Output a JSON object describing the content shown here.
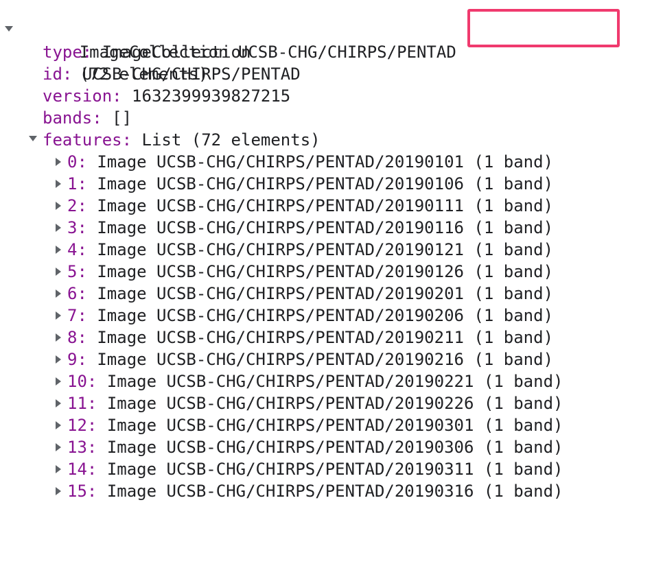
{
  "root": {
    "title": "ImageCollection UCSB-CHG/CHIRPS/PENTAD",
    "count": "(72 elements)"
  },
  "props": [
    {
      "key": "type:",
      "value": "ImageCollection"
    },
    {
      "key": "id:",
      "value": "UCSB-CHG/CHIRPS/PENTAD"
    },
    {
      "key": "version:",
      "value": "1632399939827215"
    },
    {
      "key": "bands:",
      "value": "[]"
    }
  ],
  "features": {
    "key": "features:",
    "value": "List (72 elements)"
  },
  "items": [
    {
      "index": "0:",
      "value": "Image UCSB-CHG/CHIRPS/PENTAD/20190101 (1 band)"
    },
    {
      "index": "1:",
      "value": "Image UCSB-CHG/CHIRPS/PENTAD/20190106 (1 band)"
    },
    {
      "index": "2:",
      "value": "Image UCSB-CHG/CHIRPS/PENTAD/20190111 (1 band)"
    },
    {
      "index": "3:",
      "value": "Image UCSB-CHG/CHIRPS/PENTAD/20190116 (1 band)"
    },
    {
      "index": "4:",
      "value": "Image UCSB-CHG/CHIRPS/PENTAD/20190121 (1 band)"
    },
    {
      "index": "5:",
      "value": "Image UCSB-CHG/CHIRPS/PENTAD/20190126 (1 band)"
    },
    {
      "index": "6:",
      "value": "Image UCSB-CHG/CHIRPS/PENTAD/20190201 (1 band)"
    },
    {
      "index": "7:",
      "value": "Image UCSB-CHG/CHIRPS/PENTAD/20190206 (1 band)"
    },
    {
      "index": "8:",
      "value": "Image UCSB-CHG/CHIRPS/PENTAD/20190211 (1 band)"
    },
    {
      "index": "9:",
      "value": "Image UCSB-CHG/CHIRPS/PENTAD/20190216 (1 band)"
    },
    {
      "index": "10:",
      "value": "Image UCSB-CHG/CHIRPS/PENTAD/20190221 (1 band)"
    },
    {
      "index": "11:",
      "value": "Image UCSB-CHG/CHIRPS/PENTAD/20190226 (1 band)"
    },
    {
      "index": "12:",
      "value": "Image UCSB-CHG/CHIRPS/PENTAD/20190301 (1 band)"
    },
    {
      "index": "13:",
      "value": "Image UCSB-CHG/CHIRPS/PENTAD/20190306 (1 band)"
    },
    {
      "index": "14:",
      "value": "Image UCSB-CHG/CHIRPS/PENTAD/20190311 (1 band)"
    },
    {
      "index": "15:",
      "value": "Image UCSB-CHG/CHIRPS/PENTAD/20190316 (1 band)"
    }
  ],
  "colors": {
    "key": "#881391",
    "text": "#202124",
    "highlight": "#f03a6e"
  }
}
